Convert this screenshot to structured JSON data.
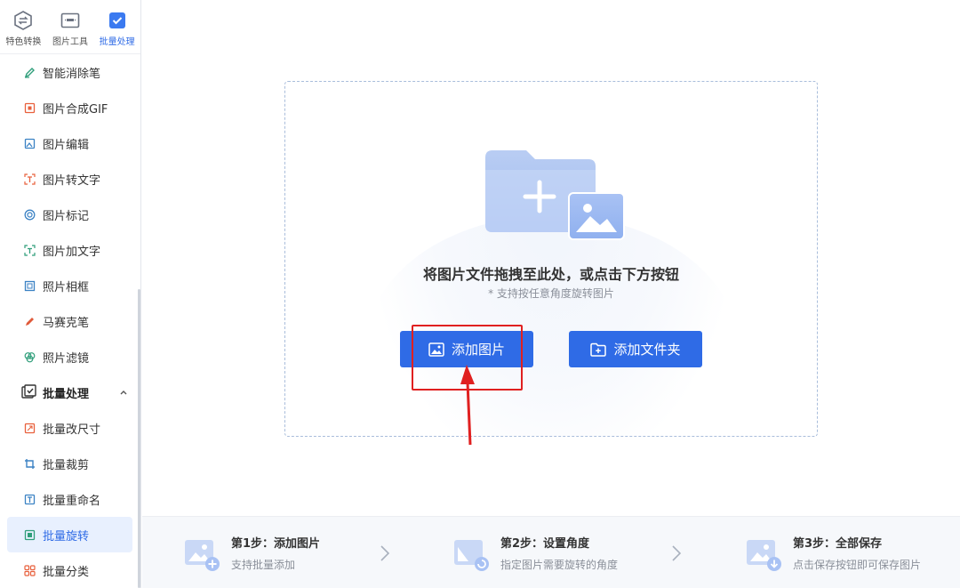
{
  "topnav": [
    {
      "label": "特色转换",
      "icon": "convert-icon"
    },
    {
      "label": "图片工具",
      "icon": "image-tools-icon"
    },
    {
      "label": "批量处理",
      "icon": "batch-icon",
      "active": true
    }
  ],
  "menu": [
    {
      "label": "智能消除笔",
      "icon": "eraser-pen-icon"
    },
    {
      "label": "图片合成GIF",
      "icon": "gif-icon"
    },
    {
      "label": "图片编辑",
      "icon": "image-edit-icon"
    },
    {
      "label": "图片转文字",
      "icon": "ocr-icon"
    },
    {
      "label": "图片标记",
      "icon": "mark-icon"
    },
    {
      "label": "图片加文字",
      "icon": "add-text-icon"
    },
    {
      "label": "照片相框",
      "icon": "frame-icon"
    },
    {
      "label": "马赛克笔",
      "icon": "mosaic-pen-icon"
    },
    {
      "label": "照片滤镜",
      "icon": "filter-icon"
    }
  ],
  "group": {
    "label": "批量处理",
    "icon": "batch-group-icon"
  },
  "submenu": [
    {
      "label": "批量改尺寸",
      "icon": "resize-icon"
    },
    {
      "label": "批量裁剪",
      "icon": "crop-icon"
    },
    {
      "label": "批量重命名",
      "icon": "rename-icon"
    },
    {
      "label": "批量旋转",
      "icon": "rotate-icon",
      "active": true
    },
    {
      "label": "批量分类",
      "icon": "classify-icon"
    }
  ],
  "dropzone": {
    "title": "将图片文件拖拽至此处，或点击下方按钮",
    "hint": "* 支持按任意角度旋转图片",
    "add_image": "添加图片",
    "add_folder": "添加文件夹"
  },
  "steps": [
    {
      "title": "第1步：添加图片",
      "desc": "支持批量添加"
    },
    {
      "title": "第2步：设置角度",
      "desc": "指定图片需要旋转的角度"
    },
    {
      "title": "第3步：全部保存",
      "desc": "点击保存按钮即可保存图片"
    }
  ],
  "colors": {
    "accent": "#2f6be6",
    "annotation": "#e02020"
  }
}
